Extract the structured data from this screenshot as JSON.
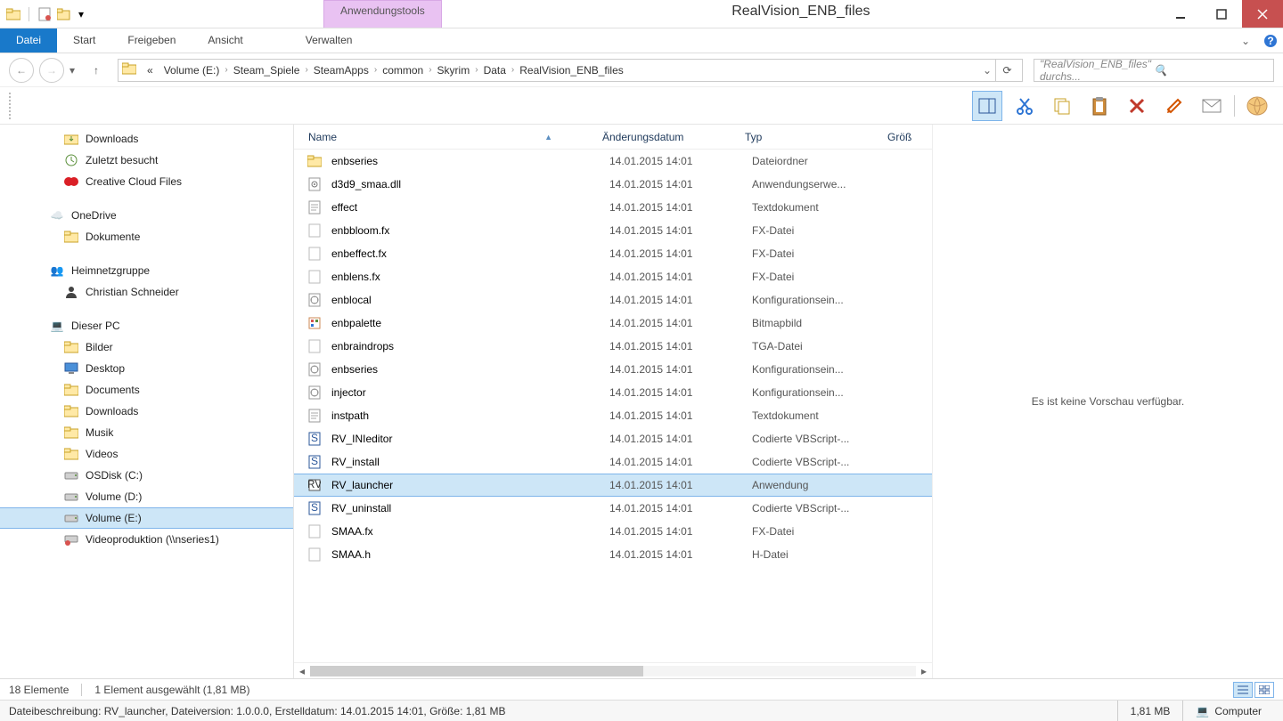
{
  "window": {
    "title": "RealVision_ENB_files",
    "tool_tab": "Anwendungstools"
  },
  "ribbon": {
    "file": "Datei",
    "tabs": [
      "Start",
      "Freigeben",
      "Ansicht"
    ],
    "tool_tab_cmd": "Verwalten"
  },
  "breadcrumb": {
    "prefix": "«",
    "parts": [
      "Volume (E:)",
      "Steam_Spiele",
      "SteamApps",
      "common",
      "Skyrim",
      "Data",
      "RealVision_ENB_files"
    ]
  },
  "search": {
    "placeholder": "\"RealVision_ENB_files\" durchs..."
  },
  "columns": {
    "name": "Name",
    "date": "Änderungsdatum",
    "type": "Typ",
    "size": "Größ"
  },
  "sidebar": {
    "quick": [
      {
        "icon": "downloads",
        "label": "Downloads"
      },
      {
        "icon": "recent",
        "label": "Zuletzt besucht"
      },
      {
        "icon": "cc",
        "label": "Creative Cloud Files"
      }
    ],
    "onedrive": {
      "label": "OneDrive",
      "children": [
        {
          "icon": "folder",
          "label": "Dokumente"
        }
      ]
    },
    "homegroup": {
      "label": "Heimnetzgruppe",
      "children": [
        {
          "icon": "person",
          "label": "Christian Schneider"
        }
      ]
    },
    "thispc": {
      "label": "Dieser PC",
      "children": [
        {
          "icon": "folder",
          "label": "Bilder"
        },
        {
          "icon": "desktop",
          "label": "Desktop"
        },
        {
          "icon": "folder",
          "label": "Documents"
        },
        {
          "icon": "folder",
          "label": "Downloads"
        },
        {
          "icon": "folder",
          "label": "Musik"
        },
        {
          "icon": "folder",
          "label": "Videos"
        },
        {
          "icon": "drive",
          "label": "OSDisk (C:)"
        },
        {
          "icon": "drive",
          "label": "Volume (D:)"
        },
        {
          "icon": "drive",
          "label": "Volume (E:)",
          "selected": true
        },
        {
          "icon": "netdrive",
          "label": "Videoproduktion (\\\\nseries1)"
        }
      ]
    }
  },
  "files": [
    {
      "icon": "folder",
      "name": "enbseries",
      "date": "14.01.2015 14:01",
      "type": "Dateiordner"
    },
    {
      "icon": "dll",
      "name": "d3d9_smaa.dll",
      "date": "14.01.2015 14:01",
      "type": "Anwendungserwe..."
    },
    {
      "icon": "txt",
      "name": "effect",
      "date": "14.01.2015 14:01",
      "type": "Textdokument"
    },
    {
      "icon": "file",
      "name": "enbbloom.fx",
      "date": "14.01.2015 14:01",
      "type": "FX-Datei"
    },
    {
      "icon": "file",
      "name": "enbeffect.fx",
      "date": "14.01.2015 14:01",
      "type": "FX-Datei"
    },
    {
      "icon": "file",
      "name": "enblens.fx",
      "date": "14.01.2015 14:01",
      "type": "FX-Datei"
    },
    {
      "icon": "ini",
      "name": "enblocal",
      "date": "14.01.2015 14:01",
      "type": "Konfigurationsein..."
    },
    {
      "icon": "bmp",
      "name": "enbpalette",
      "date": "14.01.2015 14:01",
      "type": "Bitmapbild"
    },
    {
      "icon": "file",
      "name": "enbraindrops",
      "date": "14.01.2015 14:01",
      "type": "TGA-Datei"
    },
    {
      "icon": "ini",
      "name": "enbseries",
      "date": "14.01.2015 14:01",
      "type": "Konfigurationsein..."
    },
    {
      "icon": "ini",
      "name": "injector",
      "date": "14.01.2015 14:01",
      "type": "Konfigurationsein..."
    },
    {
      "icon": "txt",
      "name": "instpath",
      "date": "14.01.2015 14:01",
      "type": "Textdokument"
    },
    {
      "icon": "vbs",
      "name": "RV_INIeditor",
      "date": "14.01.2015 14:01",
      "type": "Codierte VBScript-..."
    },
    {
      "icon": "vbs",
      "name": "RV_install",
      "date": "14.01.2015 14:01",
      "type": "Codierte VBScript-..."
    },
    {
      "icon": "exe",
      "name": "RV_launcher",
      "date": "14.01.2015 14:01",
      "type": "Anwendung",
      "selected": true
    },
    {
      "icon": "vbs",
      "name": "RV_uninstall",
      "date": "14.01.2015 14:01",
      "type": "Codierte VBScript-..."
    },
    {
      "icon": "file",
      "name": "SMAA.fx",
      "date": "14.01.2015 14:01",
      "type": "FX-Datei"
    },
    {
      "icon": "file",
      "name": "SMAA.h",
      "date": "14.01.2015 14:01",
      "type": "H-Datei"
    }
  ],
  "preview": {
    "empty_text": "Es ist keine Vorschau verfügbar."
  },
  "status1": {
    "items": "18 Elemente",
    "selection": "1 Element ausgewählt (1,81 MB)"
  },
  "status2": {
    "description": "Dateibeschreibung: RV_launcher, Dateiversion: 1.0.0.0, Erstelldatum: 14.01.2015 14:01, Größe: 1,81 MB",
    "size": "1,81 MB",
    "location": "Computer"
  }
}
